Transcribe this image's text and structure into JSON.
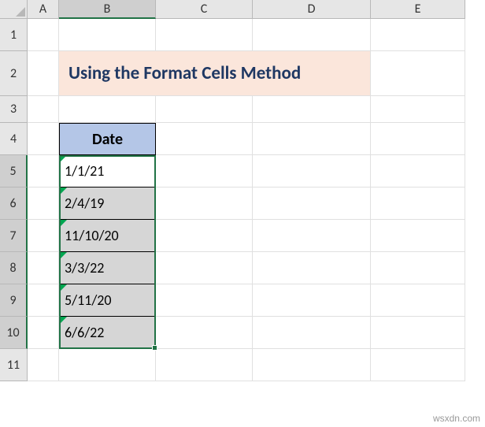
{
  "columns": [
    "A",
    "B",
    "C",
    "D",
    "E"
  ],
  "rows": [
    "1",
    "2",
    "3",
    "4",
    "5",
    "6",
    "7",
    "8",
    "9",
    "10",
    "11"
  ],
  "title": "Using the Format Cells Method",
  "table": {
    "header": "Date",
    "rows": [
      "1/1/21",
      "2/4/19",
      "11/10/20",
      "3/3/22",
      "5/11/20",
      "6/6/22"
    ]
  },
  "watermark": "wsxdn.com",
  "activeColumn": "B",
  "activeRows": [
    "5",
    "6",
    "7",
    "8",
    "9",
    "10"
  ],
  "chart_data": {
    "type": "table",
    "title": "Date",
    "categories": [
      "Date"
    ],
    "values": [
      "1/1/21",
      "2/4/19",
      "11/10/20",
      "3/3/22",
      "5/11/20",
      "6/6/22"
    ]
  }
}
